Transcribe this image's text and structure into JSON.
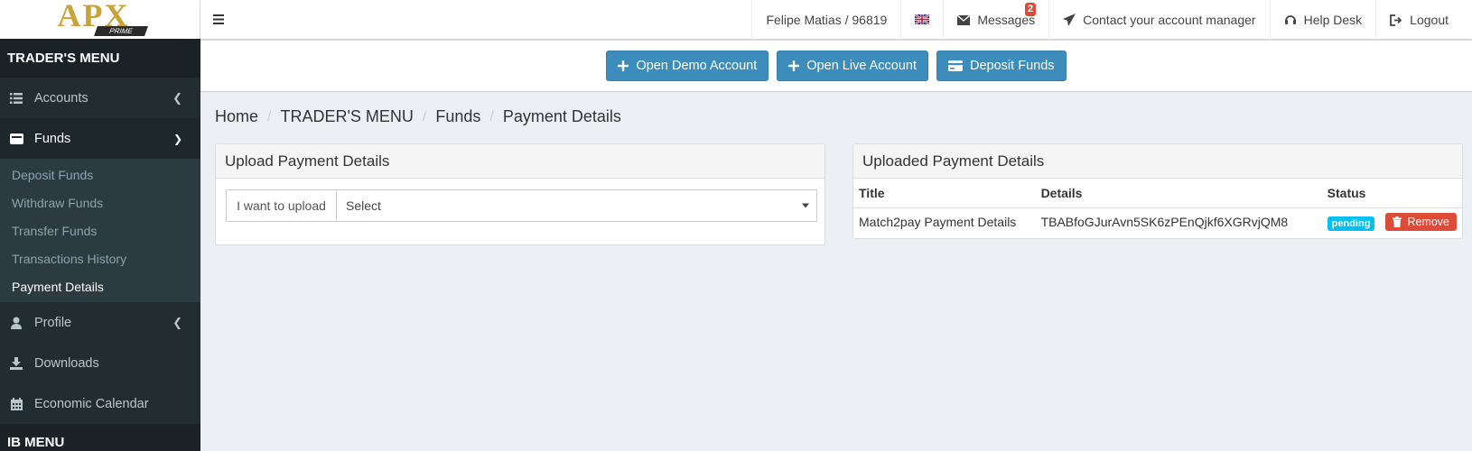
{
  "logo": {
    "text": "APX",
    "sub": "PRIME"
  },
  "sidebar": {
    "trader_header": "TRADER'S MENU",
    "items": [
      {
        "label": "Accounts",
        "icon": "list-icon"
      },
      {
        "label": "Funds",
        "icon": "wallet-icon"
      },
      {
        "label": "Profile",
        "icon": "user-icon"
      },
      {
        "label": "Downloads",
        "icon": "download-icon"
      },
      {
        "label": "Economic Calendar",
        "icon": "calendar-icon"
      }
    ],
    "funds_sub": [
      "Deposit Funds",
      "Withdraw Funds",
      "Transfer Funds",
      "Transactions History",
      "Payment Details"
    ],
    "ib_header": "IB MENU"
  },
  "topbar": {
    "user": "Felipe Matias / 96819",
    "language_flag": "uk-flag-icon",
    "messages_label": "Messages",
    "messages_count": "2",
    "contact_label": "Contact your account manager",
    "helpdesk_label": "Help Desk",
    "logout_label": "Logout"
  },
  "actions": {
    "open_demo": "Open Demo Account",
    "open_live": "Open Live Account",
    "deposit": "Deposit Funds"
  },
  "breadcrumb": [
    "Home",
    "TRADER'S MENU",
    "Funds",
    "Payment Details"
  ],
  "upload_panel": {
    "title": "Upload Payment Details",
    "addon": "I want to upload",
    "select_value": "Select"
  },
  "uploaded_panel": {
    "title": "Uploaded Payment Details",
    "columns": [
      "Title",
      "Details",
      "Status"
    ],
    "rows": [
      {
        "title": "Match2pay Payment Details",
        "details": "TBABfoGJurAvn5SK6zPEnQjkf6XGRvjQM8",
        "status": "pending",
        "action": "Remove"
      }
    ]
  },
  "colors": {
    "sidebar_bg": "#222d32",
    "primary": "#3c8dbc",
    "danger": "#dd4b39",
    "info": "#00c0ef"
  }
}
